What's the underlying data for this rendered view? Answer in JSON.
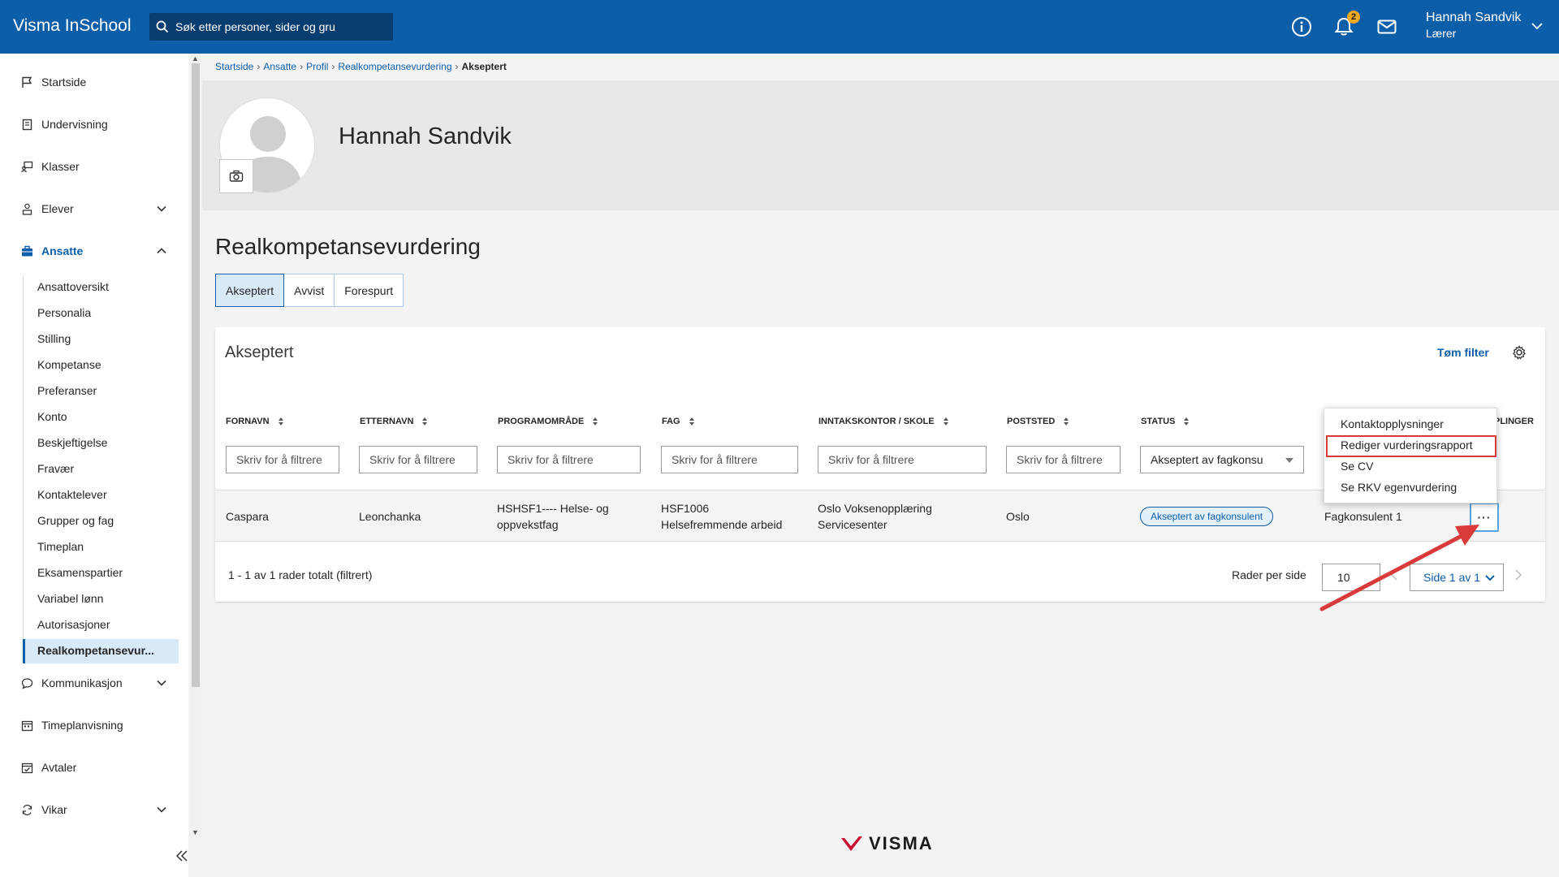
{
  "header": {
    "brand": "Visma InSchool",
    "search_placeholder": "Søk etter personer, sider og gru",
    "notification_count": "2",
    "user_name": "Hannah Sandvik",
    "user_role": "Lærer"
  },
  "sidebar": {
    "items": [
      {
        "label": "Startside",
        "icon": "flag-icon"
      },
      {
        "label": "Undervisning",
        "icon": "book-icon"
      },
      {
        "label": "Klasser",
        "icon": "classroom-icon"
      },
      {
        "label": "Elever",
        "icon": "students-icon"
      },
      {
        "label": "Ansatte",
        "icon": "briefcase-icon"
      },
      {
        "label": "Kommunikasjon",
        "icon": "chat-icon"
      },
      {
        "label": "Timeplanvisning",
        "icon": "calendar-icon"
      },
      {
        "label": "Avtaler",
        "icon": "calendar-check-icon"
      },
      {
        "label": "Vikar",
        "icon": "refresh-icon"
      }
    ],
    "sub_items": [
      "Ansattoversikt",
      "Personalia",
      "Stilling",
      "Kompetanse",
      "Preferanser",
      "Konto",
      "Beskjeftigelse",
      "Fravær",
      "Kontaktelever",
      "Grupper og fag",
      "Timeplan",
      "Eksamenspartier",
      "Variabel lønn",
      "Autorisasjoner"
    ],
    "active_sub": "Realkompetansevur..."
  },
  "breadcrumb": {
    "items": [
      "Startside",
      "Ansatte",
      "Profil",
      "Realkompetansevurdering"
    ],
    "current": "Akseptert"
  },
  "profile": {
    "name": "Hannah Sandvik"
  },
  "page": {
    "title": "Realkompetansevurdering",
    "tabs": [
      "Akseptert",
      "Avvist",
      "Forespurt"
    ]
  },
  "card": {
    "title": "Akseptert",
    "clear_filter": "Tøm filter",
    "columns": [
      "FORNAVN",
      "ETTERNAVN",
      "PROGRAMOMRÅDE",
      "FAG",
      "INNTAKSKONTOR / SKOLE",
      "POSTSTED",
      "STATUS"
    ],
    "partial_column": "PLINGER",
    "filter_placeholder": "Skriv for å filtrere",
    "status_filter_value": "Akseptert av fagkonsu",
    "row": {
      "fornavn": "Caspara",
      "etternavn": "Leonchanka",
      "programomrade_1": "HSHSF1---- Helse- og",
      "programomrade_2": "oppvekstfag",
      "fag_1": "HSF1006",
      "fag_2": "Helsefremmende arbeid",
      "skole_1": "Oslo Voksenopplæring",
      "skole_2": "Servicesenter",
      "poststed": "Oslo",
      "status": "Akseptert av fagkonsulent",
      "fagkonsulent": "Fagkonsulent 1",
      "more": "···"
    },
    "menu": [
      "Kontaktopplysninger",
      "Rediger vurderingsrapport",
      "Se CV",
      "Se RKV egenvurdering"
    ],
    "footer": {
      "count": "1 - 1 av 1 rader totalt (filtrert)",
      "rows_per_page_label": "Rader per side",
      "rows_per_page": "10",
      "page": "Side 1 av 1"
    }
  },
  "footer_logo": "VISMA",
  "colors": {
    "brand": "#0d5ea8",
    "highlight": "#d93a3a",
    "badge": "#f4a81d"
  }
}
